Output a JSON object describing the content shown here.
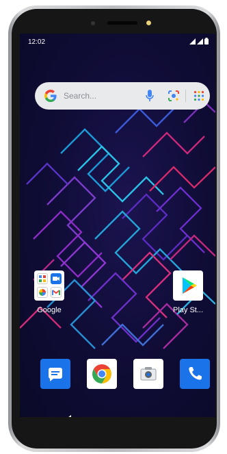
{
  "status_bar": {
    "time": "12:02"
  },
  "search": {
    "placeholder": "Search..."
  },
  "home_apps": [
    {
      "label": "Google"
    },
    {
      "label": "Play St..."
    }
  ],
  "dock": [
    {
      "icon": "messages-icon"
    },
    {
      "icon": "chrome-icon"
    },
    {
      "icon": "camera-icon"
    },
    {
      "icon": "phone-icon"
    }
  ],
  "colors": {
    "wallpaper": "#0f0c35",
    "search_bar": "#e9eaec",
    "dock_blue": "#1a73e8"
  }
}
